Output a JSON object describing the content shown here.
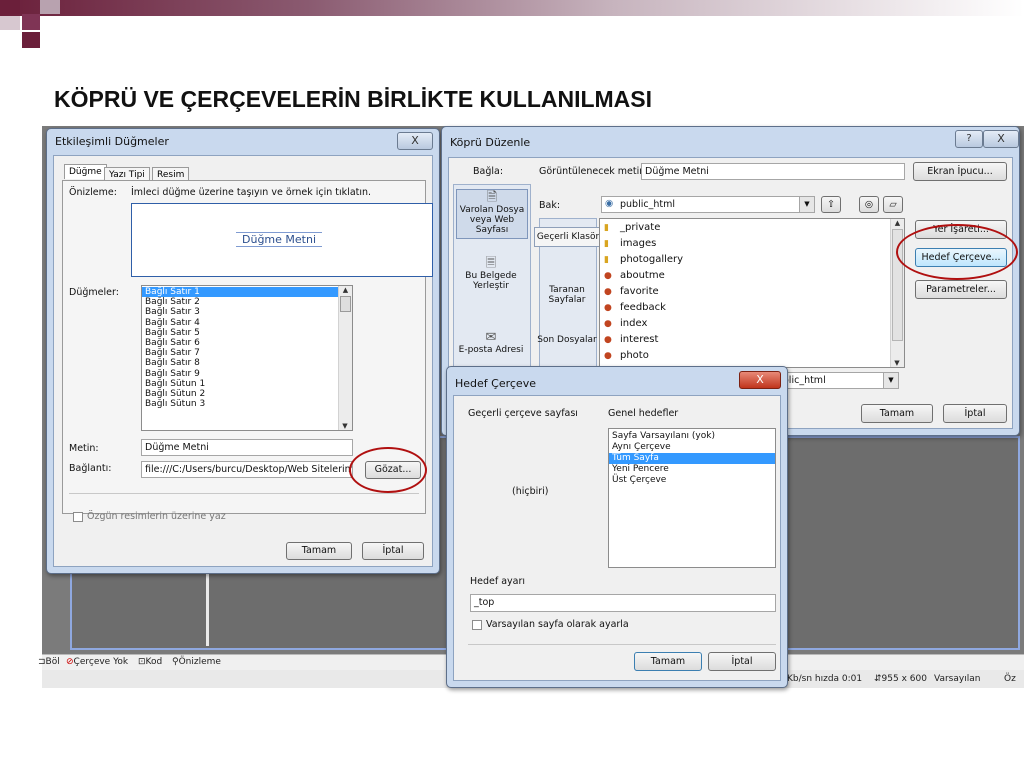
{
  "slide": {
    "title": "KÖPRÜ VE ÇERÇEVELERİN BİRLİKTE KULLANILMASI"
  },
  "etkilesimli": {
    "title": "Etkileşimli Düğmeler",
    "close": "X",
    "tabs": [
      "Düğme",
      "Yazı Tipi",
      "Resim"
    ],
    "preview_label": "Önizleme:",
    "preview_hint": "İmleci düğme üzerine taşıyın ve örnek için tıklatın.",
    "preview_button": "Düğme Metni",
    "buttons_label": "Düğmeler:",
    "buttons": [
      "Bağlı Satır 1",
      "Bağlı Satır 2",
      "Bağlı Satır 3",
      "Bağlı Satır 4",
      "Bağlı Satır 5",
      "Bağlı Satır 6",
      "Bağlı Satır 7",
      "Bağlı Satır 8",
      "Bağlı Satır 9",
      "Bağlı Sütun 1",
      "Bağlı Sütun 2",
      "Bağlı Sütun 3"
    ],
    "selected_index": 0,
    "text_label": "Metin:",
    "text_value": "Düğme Metni",
    "link_label": "Bağlantı:",
    "link_value": "file:///C:/Users/burcu/Desktop/Web Sitelerim/p",
    "browse": "Gözat...",
    "checkbox_label": "Özgün resimlerin üzerine yaz",
    "ok": "Tamam",
    "cancel": "İptal"
  },
  "kopru": {
    "title": "Köprü Düzenle",
    "help": "?",
    "close": "X",
    "link_label": "Bağla:",
    "display_text_label": "Görüntülenecek metin:",
    "display_text_value": "Düğme Metni",
    "screentip": "Ekran İpucu...",
    "side": [
      {
        "icon": "existing-file-icon",
        "label": "Varolan Dosya veya Web Sayfası"
      },
      {
        "icon": "this-document-icon",
        "label": "Bu Belgede Yerleştir"
      },
      {
        "icon": "email-address-icon",
        "label": "E-posta Adresi"
      }
    ],
    "look_label": "Bak:",
    "look_value": "public_html",
    "subtabs": [
      "Geçerli Klasör",
      "Taranan Sayfalar",
      "Son Dosyalar"
    ],
    "files": [
      {
        "name": "_private",
        "type": "folder"
      },
      {
        "name": "images",
        "type": "folder"
      },
      {
        "name": "photogallery",
        "type": "folder"
      },
      {
        "name": "aboutme",
        "type": "page"
      },
      {
        "name": "favorite",
        "type": "page"
      },
      {
        "name": "feedback",
        "type": "page"
      },
      {
        "name": "index",
        "type": "page"
      },
      {
        "name": "interest",
        "type": "page"
      },
      {
        "name": "photo",
        "type": "page"
      }
    ],
    "bookmark": "Yer İşareti...",
    "target_frame": "Hedef Çerçeve...",
    "parameters": "Parametreler...",
    "address_value": "olic_html",
    "ok": "Tamam",
    "cancel": "İptal"
  },
  "hedef": {
    "title": "Hedef Çerçeve",
    "close": "X",
    "current_label": "Geçerli çerçeve sayfası",
    "current_none": "(hiçbiri)",
    "common_label": "Genel hedefler",
    "targets": [
      "Sayfa Varsayılanı (yok)",
      "Aynı Çerçeve",
      "Tüm Sayfa",
      "Yeni Pencere",
      "Üst Çerçeve"
    ],
    "selected_index": 2,
    "setting_label": "Hedef ayarı",
    "setting_value": "_top",
    "default_checkbox": "Varsayılan sayfa olarak ayarla",
    "ok": "Tamam",
    "cancel": "İptal"
  },
  "editor": {
    "bottom_tabs": [
      "Böl",
      "Çerçeve Yok",
      "Kod",
      "Önizleme"
    ],
    "status": [
      "Kb/sn hızda 0:01",
      "955 x 600",
      "Varsayılan",
      "Öz"
    ]
  }
}
